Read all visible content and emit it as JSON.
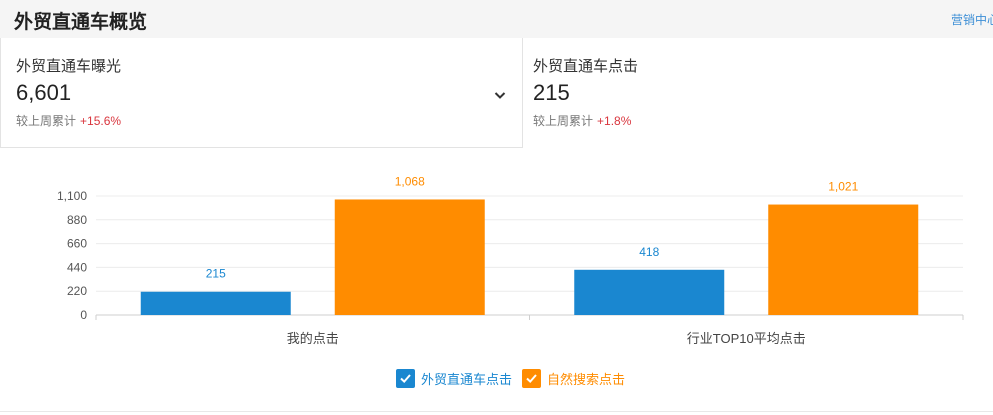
{
  "header": {
    "title": "外贸直通车概览",
    "link_text": "营销中心"
  },
  "cards": [
    {
      "label": "外贸直通车曝光",
      "value": "6,601",
      "compare_text": "较上周累计",
      "change": "+15.6%"
    },
    {
      "label": "外贸直通车点击",
      "value": "215",
      "compare_text": "较上周累计",
      "change": "+1.8%"
    }
  ],
  "icons": {
    "dropdown": "chevron-down-icon",
    "legend_check": "check-icon"
  },
  "colors": {
    "series_blue": "#1a87d0",
    "series_orange": "#ff8c00",
    "change_red": "#d9363e",
    "link": "#3d8fd6"
  },
  "chart_data": {
    "type": "bar",
    "categories": [
      "我的点击",
      "行业TOP10平均点击"
    ],
    "series": [
      {
        "name": "外贸直通车点击",
        "values": [
          215,
          418
        ],
        "color": "#1a87d0"
      },
      {
        "name": "自然搜索点击",
        "values": [
          1068,
          1021
        ],
        "color": "#ff8c00"
      }
    ],
    "value_labels": [
      [
        "215",
        "418"
      ],
      [
        "1,068",
        "1,021"
      ]
    ],
    "yticks": [
      0,
      220,
      440,
      660,
      880,
      1100
    ],
    "ytick_labels": [
      "0",
      "220",
      "440",
      "660",
      "880",
      "1,100"
    ],
    "ylim": [
      0,
      1100
    ],
    "grid": true,
    "legend_position": "bottom-center"
  }
}
